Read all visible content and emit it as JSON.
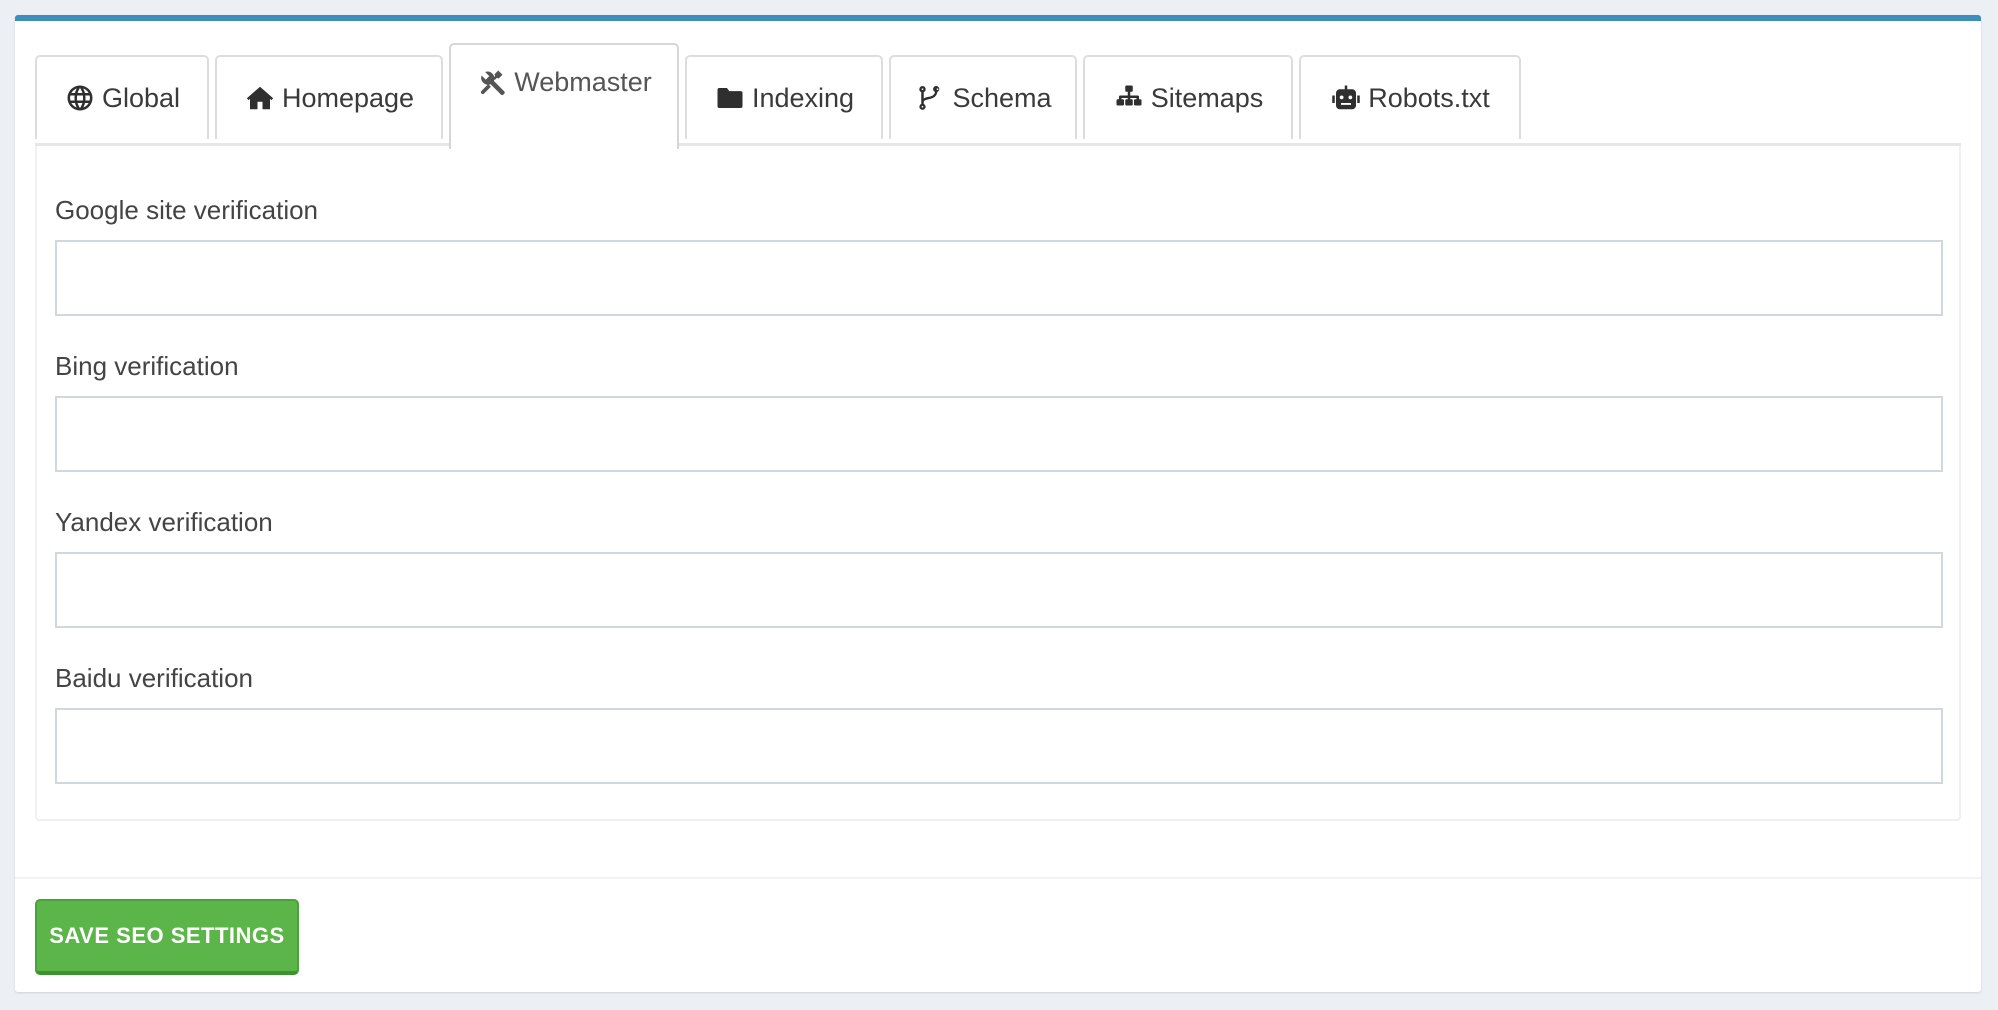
{
  "tabs": [
    {
      "label": "Global",
      "icon": "globe-icon",
      "active": false
    },
    {
      "label": "Homepage",
      "icon": "home-icon",
      "active": false
    },
    {
      "label": "Webmaster",
      "icon": "tools-icon",
      "active": true
    },
    {
      "label": "Indexing",
      "icon": "folder-icon",
      "active": false
    },
    {
      "label": "Schema",
      "icon": "code-branch-icon",
      "active": false
    },
    {
      "label": "Sitemaps",
      "icon": "sitemap-icon",
      "active": false
    },
    {
      "label": "Robots.txt",
      "icon": "robot-icon",
      "active": false
    }
  ],
  "form": {
    "fields": [
      {
        "label": "Google site verification",
        "value": "",
        "placeholder": ""
      },
      {
        "label": "Bing verification",
        "value": "",
        "placeholder": ""
      },
      {
        "label": "Yandex verification",
        "value": "",
        "placeholder": ""
      },
      {
        "label": "Baidu verification",
        "value": "",
        "placeholder": ""
      }
    ]
  },
  "footer": {
    "save_label": "SAVE SEO SETTINGS"
  },
  "colors": {
    "box_top_border": "#3c8dbc",
    "save_button": "#5cb548",
    "page_background": "#ecf0f5"
  }
}
